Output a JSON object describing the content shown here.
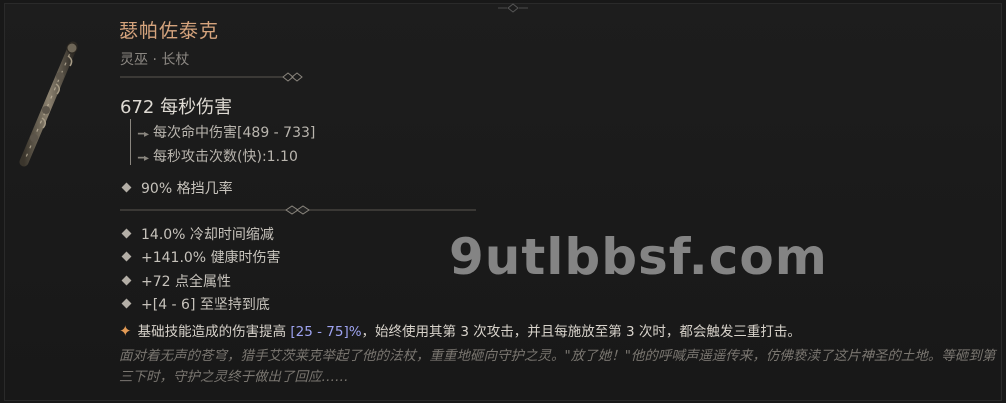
{
  "item": {
    "name": "瑟帕佐泰克",
    "type": "灵巫 · 长杖",
    "dps": "672 每秒伤害",
    "damage_per_hit": "每次命中伤害[489 - 733]",
    "attacks_per_second": "每秒攻击次数(快):1.10",
    "implicit": "90% 格挡几率",
    "affixes": [
      "14.0% 冷却时间缩减",
      "+141.0% 健康时伤害",
      "+72 点全属性",
      "+[4 - 6] 至坚持到底"
    ],
    "legendary_prefix": "基础技能造成的伤害提高 ",
    "legendary_range": "[25 - 75]%",
    "legendary_suffix": "，始终使用其第 3 次攻击，并且每施放至第 3 次时，都会触发三重打击。",
    "flavor_text": "面对着无声的苍穹，猎手艾茨莱克举起了他的法杖，重重地砸向守护之灵。\"放了她！\"他的呼喊声遥遥传来，仿佛亵渎了这片神圣的土地。等砸到第三下时，守护之灵终于做出了回应……"
  },
  "watermark": "9utlbbsf.com",
  "colors": {
    "title": "#d6a47d",
    "legendary_range": "#9ea3f0",
    "legendary_star": "#e29a55"
  },
  "icons": {
    "item_image": "staff-icon",
    "legendary_marker": "star-icon",
    "affix_marker": "diamond-icon"
  }
}
